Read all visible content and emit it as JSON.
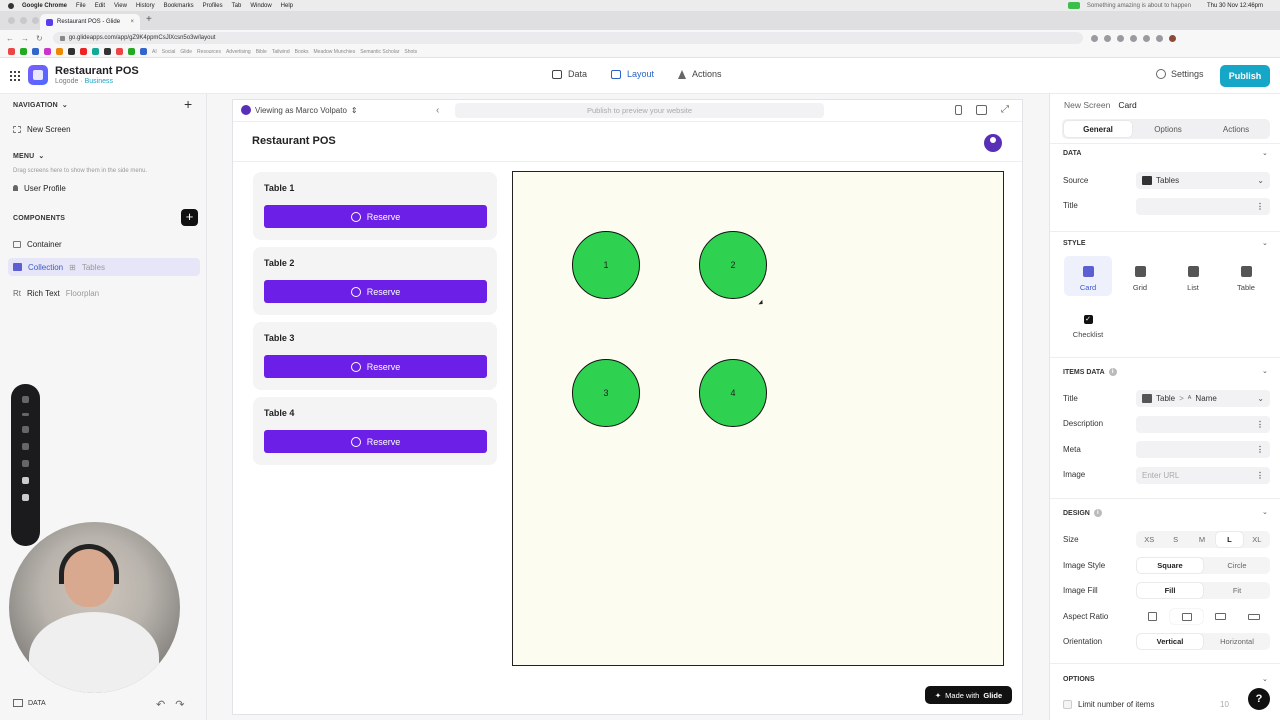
{
  "os_menubar": {
    "app_name": "Google Chrome",
    "menus": [
      "File",
      "Edit",
      "View",
      "History",
      "Bookmarks",
      "Profiles",
      "Tab",
      "Window",
      "Help"
    ],
    "clock": "Thu 30 Nov 12:46pm",
    "notice": "Something amazing is about to happen"
  },
  "browser": {
    "tab_title": "Restaurant POS - Glide",
    "url": "go.glideapps.com/app/gZ9K4ppmCsJlXcsn5o3w/layout",
    "bookmarks": [
      "AI",
      "Social",
      "Glide",
      "Resources",
      "Advertising",
      "Bible",
      "Tailwind",
      "Books",
      "Meadow Munchies",
      "Semantic Scholar",
      "Shots"
    ]
  },
  "app_header": {
    "app_title": "Restaurant POS",
    "org": "Logode",
    "separator": "·",
    "plan": "Business",
    "nav": [
      {
        "label": "Data",
        "icon": "data-icon"
      },
      {
        "label": "Layout",
        "icon": "layout-icon"
      },
      {
        "label": "Actions",
        "icon": "actions-icon"
      }
    ],
    "settings_label": "Settings",
    "publish_label": "Publish",
    "colors": {
      "accent": "#16a6c7",
      "active_nav": "#2b63c9"
    }
  },
  "left_sidebar": {
    "navigation_title": "NAVIGATION",
    "nav_items": [
      "New Screen"
    ],
    "menu_title": "MENU",
    "menu_hint": "Drag screens here to show them in the side menu.",
    "menu_items": [
      "User Profile"
    ],
    "components_title": "COMPONENTS",
    "components": [
      {
        "label": "Container",
        "sub": ""
      },
      {
        "label": "Collection",
        "sub": "Tables"
      },
      {
        "label": "Rich Text",
        "sub": "Floorplan"
      }
    ],
    "footer_label": "DATA"
  },
  "canvas": {
    "viewing_as": "Viewing as Marco Volpato",
    "preview_placeholder": "Publish to preview your website",
    "page_title": "Restaurant POS",
    "cards": [
      {
        "title": "Table 1",
        "button": "Reserve"
      },
      {
        "title": "Table 2",
        "button": "Reserve"
      },
      {
        "title": "Table 3",
        "button": "Reserve"
      },
      {
        "title": "Table 4",
        "button": "Reserve"
      }
    ],
    "floorplan_tables": [
      "1",
      "2",
      "3",
      "4"
    ],
    "made_with_prefix": "Made with",
    "made_with_brand": "Glide",
    "colors": {
      "reserve_button": "#6c1fe6",
      "table_fill": "#2fd150",
      "floorplan_bg": "#fcfdf0"
    }
  },
  "right_panel": {
    "breadcrumb": [
      "New Screen",
      "Card"
    ],
    "tabs": [
      "General",
      "Options",
      "Actions"
    ],
    "active_tab": "General",
    "data_section": "DATA",
    "source_label": "Source",
    "source_value": "Tables",
    "title_label": "Title",
    "style_section": "STYLE",
    "styles": [
      "Card",
      "Grid",
      "List",
      "Table",
      "Checklist"
    ],
    "active_style": "Card",
    "items_data_section": "ITEMS DATA",
    "items": {
      "title_label": "Title",
      "title_table": "Table",
      "title_chevron": ">",
      "title_field": "Name",
      "description_label": "Description",
      "meta_label": "Meta",
      "image_label": "Image",
      "image_placeholder": "Enter URL"
    },
    "design_section": "DESIGN",
    "size_label": "Size",
    "sizes": [
      "XS",
      "S",
      "M",
      "L",
      "XL"
    ],
    "active_size": "L",
    "image_style_label": "Image Style",
    "image_styles": [
      "Square",
      "Circle"
    ],
    "active_image_style": "Square",
    "image_fill_label": "Image Fill",
    "image_fills": [
      "Fill",
      "Fit"
    ],
    "active_image_fill": "Fill",
    "aspect_ratio_label": "Aspect Ratio",
    "orientation_label": "Orientation",
    "orientations": [
      "Vertical",
      "Horizontal"
    ],
    "active_orientation": "Vertical",
    "options_section": "OPTIONS",
    "limit_label": "Limit number of items",
    "limit_value": "10",
    "help_label": "?"
  }
}
